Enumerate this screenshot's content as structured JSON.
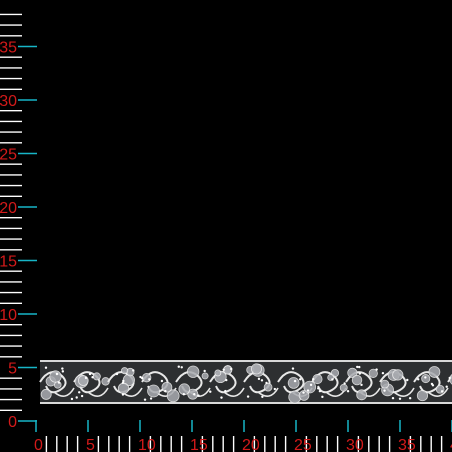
{
  "ruler": {
    "units": "mm",
    "tick_color": "#ffffff",
    "major_tick_color": "#17b5c7",
    "label_color": "#d21a1a",
    "vertical_labels": [
      "0",
      "5",
      "10",
      "15",
      "20",
      "25",
      "30",
      "35"
    ],
    "horizontal_labels": [
      "0",
      "5",
      "10",
      "15",
      "20",
      "25",
      "30",
      "35",
      "4"
    ]
  },
  "trim": {
    "description_icon": "sequin-lace-trim",
    "base_color": "#3b3d40",
    "thread_color": "#e8e8e8",
    "sequin_color": "#a9abb0"
  }
}
